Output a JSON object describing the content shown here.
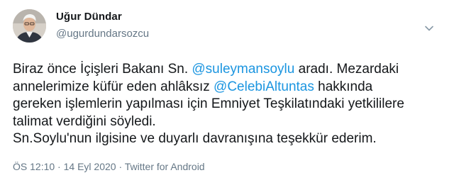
{
  "user": {
    "name": "Uğur Dündar",
    "handle": "@ugurdundarsozcu"
  },
  "tweet": {
    "line1_a": "Biraz önce İçişleri Bakanı Sn. ",
    "mention1": "@suleymansoylu",
    "line1_b": " aradı. Mezardaki",
    "line2_a": "annelerimize küfür eden ahlâksız ",
    "mention2": "@CelebiAltuntas",
    "line2_b": " hakkında",
    "line3": "gereken işlemlerin yapılması için Emniyet Teşkilatındaki yetkililere",
    "line4": "talimat verdiğini söyledi.",
    "line5": "Sn.Soylu'nun ilgisine ve duyarlı davranışına teşekkür ederim."
  },
  "meta": {
    "time": "ÖS 12:10",
    "separator1": " · ",
    "date": "14 Eyl 2020",
    "separator2": " · ",
    "source": "Twitter for Android"
  },
  "colors": {
    "mention": "#1b95e0",
    "secondary_text": "#657786",
    "primary_text": "#14171a"
  },
  "icons": {
    "menu": "chevron-down-icon"
  }
}
